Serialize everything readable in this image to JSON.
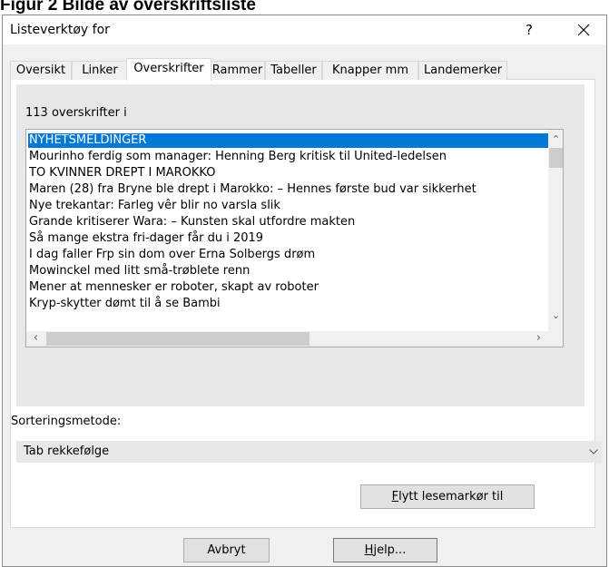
{
  "caption": "Figur 2 Bilde av overskriftsliste",
  "dialog": {
    "title": "Listeverktøy for",
    "help_glyph": "?",
    "tabs": [
      {
        "label": "Oversikt",
        "active": false
      },
      {
        "label": "Linker",
        "active": false
      },
      {
        "label": "Overskrifter",
        "active": true
      },
      {
        "label": "Rammer",
        "active": false
      },
      {
        "label": "Tabeller",
        "active": false
      },
      {
        "label": "Knapper mm",
        "active": false
      },
      {
        "label": "Landemerker",
        "active": false
      }
    ],
    "count_text": "113 overskrifter i",
    "headings": [
      "NYHETSMELDINGER",
      "Mourinho ferdig som manager: Henning Berg kritisk til United-ledelsen",
      "TO KVINNER DREPT I MAROKKO",
      "Maren (28) fra Bryne ble drept i Marokko: – Hennes første bud var sikkerhet",
      "Nye trekantar: Farleg vêr blir no varsla slik",
      "Grande kritiserer Wara: – Kunsten skal utfordre makten",
      "Så mange ekstra fri-dager får du i 2019",
      "I dag faller Frp sin dom over Erna Solbergs drøm",
      "Mowinckel med litt små-trøblete renn",
      "Mener at mennesker er roboter, skapt av roboter",
      "Kryp-skytter dømt til å se Bambi"
    ],
    "selected_index": 0,
    "sort_label": "Sorteringsmetode:",
    "sort_value": "Tab rekkefølge",
    "move_button": {
      "mnemonic": "F",
      "rest": "lytt lesemarkør til"
    },
    "cancel_button": "Avbryt",
    "help_button": {
      "mnemonic": "H",
      "rest": "jelp..."
    }
  }
}
